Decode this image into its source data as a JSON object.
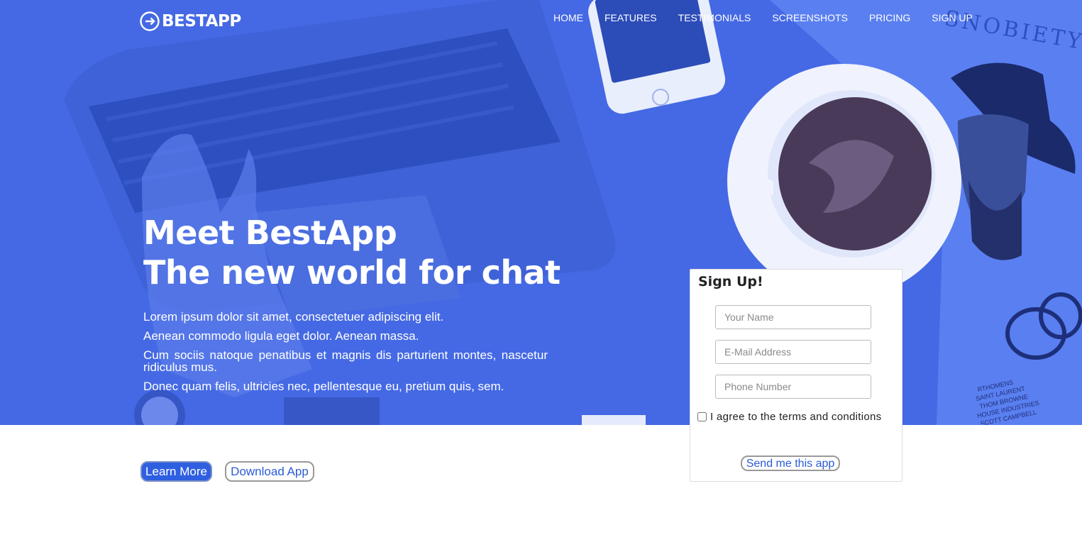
{
  "brand": {
    "name": "BESTAPP"
  },
  "nav": [
    {
      "label": "HOME"
    },
    {
      "label": "FEATURES"
    },
    {
      "label": "TESTIMONIALS"
    },
    {
      "label": "SCREENSHOTS"
    },
    {
      "label": "PRICING"
    },
    {
      "label": "SIGN UP"
    }
  ],
  "hero": {
    "headline_line1": "Meet BestApp",
    "headline_line2": "The new world for chat",
    "paragraphs": [
      "Lorem ipsum dolor sit amet, consectetuer adipiscing elit.",
      "Aenean commodo ligula eget dolor. Aenean massa.",
      "Cum sociis natoque penatibus et magnis dis parturient montes, nascetur ridiculus mus.",
      "Donec quam felis, ultricies nec, pellentesque eu, pretium quis, sem."
    ],
    "background_text": "SNOBIETY",
    "book_text": [
      "RTHOMENS",
      "SAINT LAURENT",
      "THOM BROWNE",
      "HOUSE INDUSTRIES",
      "SCOTT CAMPBELL"
    ]
  },
  "signup": {
    "title": "Sign Up!",
    "name_placeholder": "Your Name",
    "email_placeholder": "E-Mail Address",
    "phone_placeholder": "Phone Number",
    "terms_label": "I agree to the terms and conditions",
    "submit_label": "Send me this app"
  },
  "cta": {
    "learn_more": "Learn More",
    "download_app": "Download App"
  },
  "colors": {
    "hero_blue": "#4569e4",
    "primary_button": "#2f5fe1",
    "link_blue": "#2a5bd7"
  }
}
